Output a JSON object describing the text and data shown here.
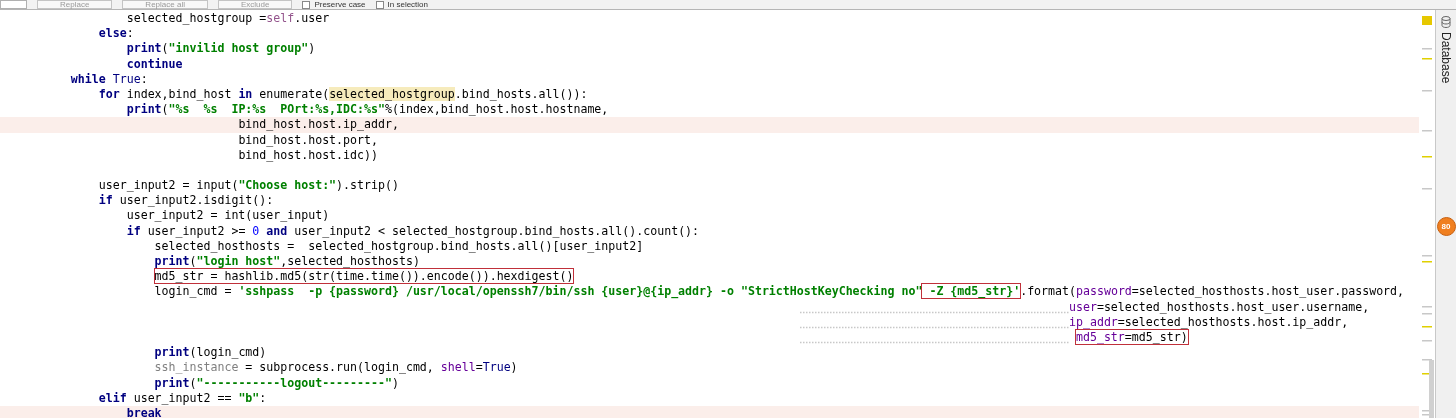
{
  "toolbar": {
    "buttons": [
      "Replace",
      "Replace all",
      "Exclude"
    ],
    "checkboxes": [
      {
        "label": "Preserve case",
        "checked": false
      },
      {
        "label": "In selection",
        "checked": false
      }
    ]
  },
  "lines": [
    {
      "kind": "code",
      "highlighted": false,
      "segments": [
        {
          "kind": "plain",
          "text": "                selected_hostgroup ="
        },
        {
          "kind": "self",
          "text": "self"
        },
        {
          "kind": "plain",
          "text": ".user"
        }
      ]
    },
    {
      "kind": "code",
      "highlighted": false,
      "segments": [
        {
          "kind": "keyword",
          "text": "            else"
        },
        {
          "kind": "plain",
          "text": ":"
        }
      ]
    },
    {
      "kind": "code",
      "highlighted": false,
      "segments": [
        {
          "kind": "keyword",
          "text": "                print"
        },
        {
          "kind": "plain",
          "text": "("
        },
        {
          "kind": "string",
          "text": "\"invilid host group\""
        },
        {
          "kind": "plain",
          "text": ")"
        }
      ]
    },
    {
      "kind": "code",
      "highlighted": false,
      "segments": [
        {
          "kind": "keyword",
          "text": "                continue"
        }
      ]
    },
    {
      "kind": "code",
      "highlighted": false,
      "segments": [
        {
          "kind": "keyword",
          "text": "        while"
        },
        {
          "kind": "constant",
          "text": " True"
        },
        {
          "kind": "plain",
          "text": ":"
        }
      ]
    },
    {
      "kind": "code",
      "highlighted": false,
      "segments": [
        {
          "kind": "keyword",
          "text": "            for"
        },
        {
          "kind": "plain",
          "text": " index,bind_host "
        },
        {
          "kind": "keyword",
          "text": "in"
        },
        {
          "kind": "plain",
          "text": " enumerate("
        },
        {
          "kind": "match",
          "text": "selected_hostgroup"
        },
        {
          "kind": "plain",
          "text": ".bind_hosts.all()):"
        }
      ]
    },
    {
      "kind": "code",
      "highlighted": false,
      "segments": [
        {
          "kind": "keyword",
          "text": "                print"
        },
        {
          "kind": "plain",
          "text": "("
        },
        {
          "kind": "string",
          "text": "\"%s  %s  IP:%s  POrt:%s,IDC:%s\""
        },
        {
          "kind": "plain",
          "text": "%(index,bind_host.host.hostname,"
        }
      ]
    },
    {
      "kind": "code",
      "highlighted": true,
      "segments": [
        {
          "kind": "plain",
          "text": "                                bind_host.host.ip_addr,"
        }
      ]
    },
    {
      "kind": "code",
      "highlighted": false,
      "segments": [
        {
          "kind": "plain",
          "text": "                                bind_host.host.port,"
        }
      ]
    },
    {
      "kind": "code",
      "highlighted": false,
      "segments": [
        {
          "kind": "plain",
          "text": "                                bind_host.host.idc))"
        }
      ]
    },
    {
      "kind": "blank"
    },
    {
      "kind": "code",
      "highlighted": false,
      "segments": [
        {
          "kind": "plain",
          "text": "            user_input2 = input("
        },
        {
          "kind": "string",
          "text": "\"Choose host:\""
        },
        {
          "kind": "plain",
          "text": ").strip()"
        }
      ]
    },
    {
      "kind": "code",
      "highlighted": false,
      "segments": [
        {
          "kind": "keyword",
          "text": "            if"
        },
        {
          "kind": "plain",
          "text": " user_input2.isdigit():"
        }
      ]
    },
    {
      "kind": "code",
      "highlighted": false,
      "segments": [
        {
          "kind": "plain",
          "text": "                user_input2 = int(user_input)"
        }
      ]
    },
    {
      "kind": "code",
      "highlighted": false,
      "segments": [
        {
          "kind": "keyword",
          "text": "                if"
        },
        {
          "kind": "plain",
          "text": " user_input2 >= "
        },
        {
          "kind": "number",
          "text": "0"
        },
        {
          "kind": "keyword",
          "text": " and"
        },
        {
          "kind": "plain",
          "text": " user_input2 < selected_hostgroup.bind_hosts.all().count():"
        }
      ]
    },
    {
      "kind": "code",
      "highlighted": false,
      "segments": [
        {
          "kind": "plain",
          "text": "                    selected_hosthosts =  selected_hostgroup.bind_hosts.all()[user_input2]"
        }
      ]
    },
    {
      "kind": "code",
      "highlighted": false,
      "segments": [
        {
          "kind": "keyword",
          "text": "                    print"
        },
        {
          "kind": "plain",
          "text": "("
        },
        {
          "kind": "string",
          "text": "\"login host\""
        },
        {
          "kind": "plain",
          "text": ",selected_hosthosts)"
        }
      ]
    },
    {
      "kind": "code",
      "highlighted": false,
      "segments": [
        {
          "kind": "box",
          "segments": [
            {
              "kind": "plain",
              "text": "                    md5_str = hashlib.md5(str(time.time()).encode()).hexdigest()"
            }
          ]
        }
      ]
    },
    {
      "kind": "code",
      "highlighted": false,
      "segments": [
        {
          "kind": "plain",
          "text": "                    login_cmd = "
        },
        {
          "kind": "string",
          "text": "'sshpass  -p {password} /usr/local/openssh7/bin/ssh {user}@{ip_addr} -o \"StrictHostKeyChecking no\""
        },
        {
          "kind": "box",
          "segments": [
            {
              "kind": "string",
              "text": " -Z {md5_str}'"
            }
          ]
        },
        {
          "kind": "plain",
          "text": ".format("
        },
        {
          "kind": "param",
          "text": "password"
        },
        {
          "kind": "plain",
          "text": "=selected_hosthosts.host_user.password,"
        }
      ]
    },
    {
      "kind": "continuation",
      "highlighted": false,
      "segments": [
        {
          "kind": "param",
          "text": "                                                                                                                                                       user"
        },
        {
          "kind": "plain",
          "text": "=selected_hosthosts.host_user.username,"
        }
      ]
    },
    {
      "kind": "continuation",
      "highlighted": false,
      "segments": [
        {
          "kind": "param",
          "text": "                                                                                                                                                       ip_addr"
        },
        {
          "kind": "plain",
          "text": "=selected_hosthosts.host.ip_addr,"
        }
      ]
    },
    {
      "kind": "continuation",
      "highlighted": false,
      "segments": [
        {
          "kind": "box",
          "segments": [
            {
              "kind": "param",
              "text": "                                                                                                                                                        md5_str"
            },
            {
              "kind": "plain",
              "text": "=md5_str)"
            }
          ]
        }
      ]
    },
    {
      "kind": "code",
      "highlighted": false,
      "segments": [
        {
          "kind": "keyword",
          "text": "                    print"
        },
        {
          "kind": "plain",
          "text": "(login_cmd)"
        }
      ]
    },
    {
      "kind": "code",
      "highlighted": false,
      "segments": [
        {
          "kind": "unused",
          "text": "                    ssh_instance"
        },
        {
          "kind": "plain",
          "text": " = subprocess.run(login_cmd, "
        },
        {
          "kind": "param",
          "text": "shell"
        },
        {
          "kind": "plain",
          "text": "="
        },
        {
          "kind": "constant",
          "text": "True"
        },
        {
          "kind": "plain",
          "text": ")"
        }
      ]
    },
    {
      "kind": "code",
      "highlighted": false,
      "segments": [
        {
          "kind": "keyword",
          "text": "                    print"
        },
        {
          "kind": "plain",
          "text": "("
        },
        {
          "kind": "string",
          "text": "\"-----------logout---------\""
        },
        {
          "kind": "plain",
          "text": ")"
        }
      ]
    },
    {
      "kind": "code",
      "highlighted": false,
      "segments": [
        {
          "kind": "keyword",
          "text": "            elif"
        },
        {
          "kind": "plain",
          "text": " user_input2 == "
        },
        {
          "kind": "string",
          "text": "\"b\""
        },
        {
          "kind": "plain",
          "text": ":"
        }
      ]
    },
    {
      "kind": "code",
      "highlighted": true,
      "segments": [
        {
          "kind": "keyword",
          "text": "                break"
        }
      ]
    }
  ],
  "side_panel": {
    "tab": "Database"
  },
  "badge": "80"
}
